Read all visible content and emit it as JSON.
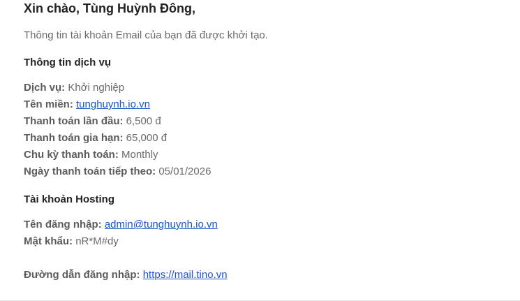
{
  "greeting": "Xin chào, Tùng Huỳnh Đông,",
  "intro": "Thông tin tài khoản Email của bạn đã được khởi tạo.",
  "service_section": {
    "title": "Thông tin dịch vụ",
    "service": {
      "label": "Dịch vụ:",
      "value": "Khởi nghiệp"
    },
    "domain": {
      "label": "Tên miền:",
      "value": "tunghuynh.io.vn"
    },
    "first_payment": {
      "label": "Thanh toán lần đầu:",
      "value": "6,500 đ"
    },
    "renewal": {
      "label": "Thanh toán gia hạn:",
      "value": "65,000 đ"
    },
    "billing_cycle": {
      "label": "Chu kỳ thanh toán:",
      "value": "Monthly"
    },
    "next_due": {
      "label": "Ngày thanh toán tiếp theo:",
      "value": "05/01/2026"
    }
  },
  "hosting_section": {
    "title": "Tài khoản Hosting",
    "username": {
      "label": "Tên đăng nhập:",
      "value": "admin@tunghuynh.io.vn"
    },
    "password": {
      "label": "Mật khẩu:",
      "value": "nR*M#dy"
    }
  },
  "login": {
    "label": "Đường dẫn đăng nhập:",
    "value": "https://mail.tino.vn"
  },
  "colors": {
    "text_dark": "#202124",
    "label": "#5b5b5b",
    "value": "#6a6a6a",
    "link": "#1a56c8",
    "background": "#ffffff"
  }
}
